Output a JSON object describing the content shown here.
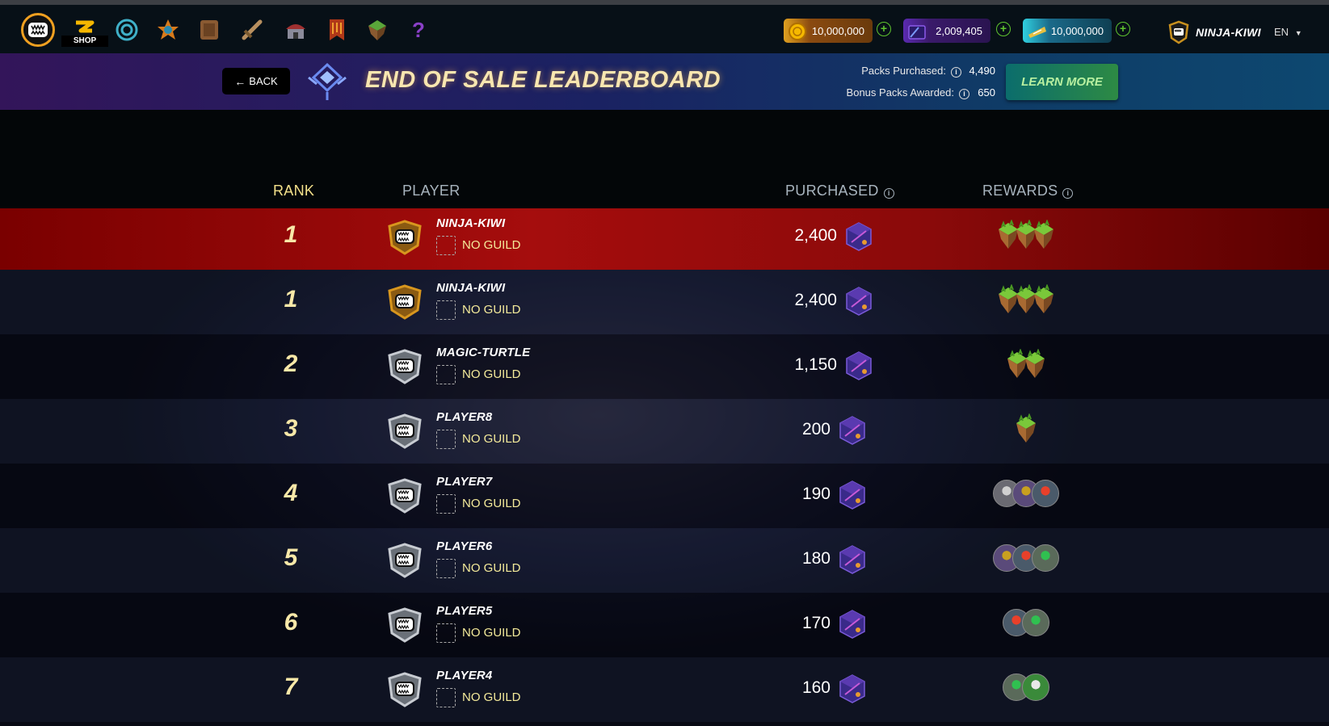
{
  "nav": {
    "shop_label": "SHOP",
    "currencies": [
      {
        "name": "gold",
        "value": "10,000,000"
      },
      {
        "name": "credits",
        "value": "2,009,405"
      },
      {
        "name": "vouchers",
        "value": "10,000,000"
      }
    ],
    "username": "NINJA-KIWI",
    "language": "EN"
  },
  "banner": {
    "back_label": "BACK",
    "title": "END OF SALE LEADERBOARD",
    "packs_purchased_label": "Packs Purchased:",
    "packs_purchased_value": "4,490",
    "bonus_packs_label": "Bonus Packs Awarded:",
    "bonus_packs_value": "650",
    "learn_more_label": "LEARN MORE"
  },
  "table": {
    "headers": {
      "rank": "RANK",
      "player": "PLAYER",
      "purchased": "PURCHASED",
      "rewards": "REWARDS"
    },
    "rows": [
      {
        "rank": "1",
        "player": "NINJA-KIWI",
        "guild": "NO GUILD",
        "purchased": "2,400",
        "badge": "gold",
        "reward_type": "island",
        "reward_count": 3,
        "highlight": true
      },
      {
        "rank": "1",
        "player": "NINJA-KIWI",
        "guild": "NO GUILD",
        "purchased": "2,400",
        "badge": "gold",
        "reward_type": "island",
        "reward_count": 3,
        "highlight": false
      },
      {
        "rank": "2",
        "player": "MAGIC-TURTLE",
        "guild": "NO GUILD",
        "purchased": "1,150",
        "badge": "silver",
        "reward_type": "island",
        "reward_count": 2,
        "highlight": false
      },
      {
        "rank": "3",
        "player": "PLAYER8",
        "guild": "NO GUILD",
        "purchased": "200",
        "badge": "silver",
        "reward_type": "island",
        "reward_count": 1,
        "highlight": false
      },
      {
        "rank": "4",
        "player": "PLAYER7",
        "guild": "NO GUILD",
        "purchased": "190",
        "badge": "silver",
        "reward_type": "monster",
        "reward_count": 3,
        "highlight": false
      },
      {
        "rank": "5",
        "player": "PLAYER6",
        "guild": "NO GUILD",
        "purchased": "180",
        "badge": "silver",
        "reward_type": "monster",
        "reward_count": 3,
        "highlight": false
      },
      {
        "rank": "6",
        "player": "PLAYER5",
        "guild": "NO GUILD",
        "purchased": "170",
        "badge": "silver",
        "reward_type": "monster",
        "reward_count": 2,
        "highlight": false
      },
      {
        "rank": "7",
        "player": "PLAYER4",
        "guild": "NO GUILD",
        "purchased": "160",
        "badge": "silver",
        "reward_type": "monster",
        "reward_count": 2,
        "highlight": false
      }
    ]
  },
  "colors": {
    "accent_gold": "#f0a020",
    "highlight_row": "#a50d0d",
    "rank_text": "#f8e8a8",
    "guild_text": "#f4ea9a"
  }
}
